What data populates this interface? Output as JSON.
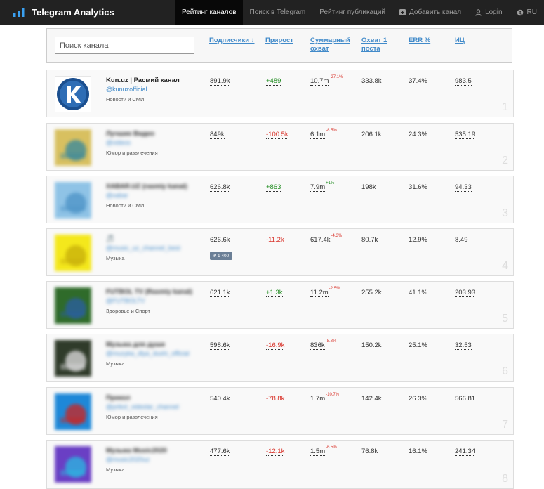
{
  "app": {
    "title": "Telegram Analytics"
  },
  "nav": {
    "items": [
      {
        "label": "Рейтинг каналов"
      },
      {
        "label": "Поиск в Telegram"
      },
      {
        "label": "Рейтинг публикаций"
      },
      {
        "label": "Добавить канал"
      },
      {
        "label": "Login"
      },
      {
        "label": "RU"
      }
    ]
  },
  "search": {
    "placeholder": "Поиск канала",
    "value": ""
  },
  "columns": {
    "subscribers": "Подписчики ↓",
    "growth": "Прирост",
    "total_reach": "Суммарный охват",
    "post_reach": "Охват 1 поста",
    "err": "ERR %",
    "ic": "ИЦ"
  },
  "channels": [
    {
      "rank": "1",
      "name": "Kun.uz | Расмий канал",
      "username": "@kunuzofficial",
      "category": "Новости и СМИ",
      "subscribers": "891.9k",
      "growth": "+489",
      "reach": "10.7m",
      "reach_delta": "-27.1%",
      "post_reach": "333.8k",
      "err": "37.4%",
      "ic": "983.5",
      "colors": [
        "#1b4f8f",
        "#2e6db5"
      ]
    },
    {
      "rank": "2",
      "name": "Лучшие Видео",
      "username": "@videos",
      "category": "Юмор и развлечения",
      "subscribers": "849k",
      "growth": "-100.5k",
      "reach": "6.1m",
      "reach_delta": "-8.5%",
      "post_reach": "206.1k",
      "err": "24.3%",
      "ic": "535.19",
      "colors": [
        "#d8c060",
        "#3d8a9a"
      ]
    },
    {
      "rank": "3",
      "name": "XABAR.UZ (rasmiy kanal)",
      "username": "@xabar",
      "category": "Новости и СМИ",
      "subscribers": "626.8k",
      "growth": "+863",
      "reach": "7.9m",
      "reach_delta": "+1%",
      "post_reach": "198k",
      "err": "31.6%",
      "ic": "94.33",
      "colors": [
        "#8fc3e6",
        "#4f95c8"
      ]
    },
    {
      "rank": "4",
      "name": "🎵",
      "username": "@music_uz_channel_best",
      "category": "Музыка",
      "subscribers": "626.6k",
      "growth": "-11.2k",
      "reach": "617.4k",
      "reach_delta": "-4.3%",
      "post_reach": "80.7k",
      "err": "12.9%",
      "ic": "8.49",
      "badge": "₽ 1 400",
      "colors": [
        "#f4e81c",
        "#c9b10b"
      ]
    },
    {
      "rank": "5",
      "name": "FUTBOL TV (Rasmiy kanal)",
      "username": "@FUTBOLTV",
      "category": "Здоровье и Спорт",
      "subscribers": "621.1k",
      "growth": "+1.3k",
      "reach": "11.2m",
      "reach_delta": "-2.5%",
      "post_reach": "255.2k",
      "err": "41.1%",
      "ic": "203.93",
      "colors": [
        "#2f6b2a",
        "#2a5f9e"
      ]
    },
    {
      "rank": "6",
      "name": "Музыка для души",
      "username": "@muzyka_dlya_dushi_official",
      "category": "Музыка",
      "subscribers": "598.6k",
      "growth": "-16.9k",
      "reach": "836k",
      "reach_delta": "-8.8%",
      "post_reach": "150.2k",
      "err": "25.1%",
      "ic": "32.53",
      "colors": [
        "#2f3b2a",
        "#d7d7d7"
      ]
    },
    {
      "rank": "7",
      "name": "Прикол",
      "username": "@prikol_videolar_channel",
      "category": "Юмор и развлечения",
      "subscribers": "540.4k",
      "growth": "-78.8k",
      "reach": "1.7m",
      "reach_delta": "-10.7%",
      "post_reach": "142.4k",
      "err": "26.3%",
      "ic": "566.81",
      "colors": [
        "#1e88d8",
        "#c42828"
      ]
    },
    {
      "rank": "8",
      "name": "Музыка Music2020",
      "username": "@music2020uz",
      "category": "Музыка",
      "subscribers": "477.6k",
      "growth": "-12.1k",
      "reach": "1.5m",
      "reach_delta": "-6.5%",
      "post_reach": "76.8k",
      "err": "16.1%",
      "ic": "241.34",
      "colors": [
        "#6a3fc4",
        "#2db3e0"
      ]
    }
  ]
}
